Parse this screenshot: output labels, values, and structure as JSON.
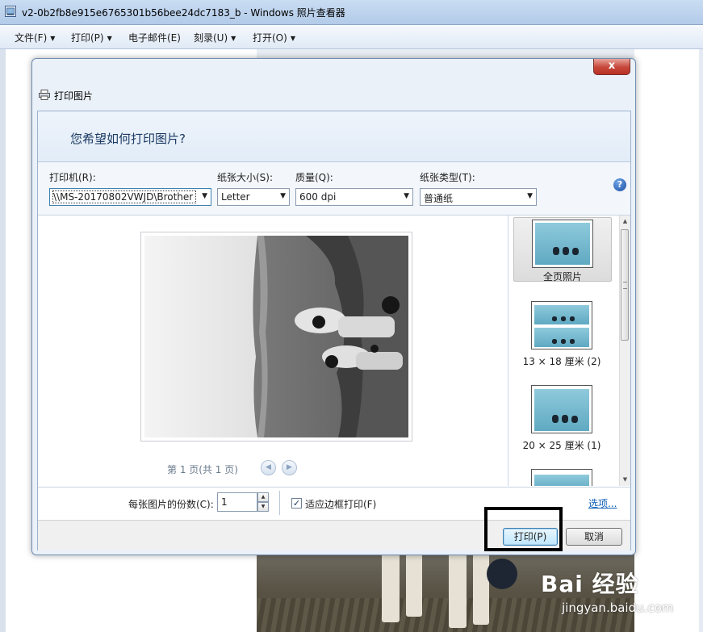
{
  "window": {
    "title": "v2-0b2fb8e915e6765301b56bee24dc7183_b - Windows 照片查看器"
  },
  "menu": {
    "items": [
      {
        "label": "文件(F)",
        "has_arrow": true
      },
      {
        "label": "打印(P)",
        "has_arrow": true
      },
      {
        "label": "电子邮件(E)",
        "has_arrow": false
      },
      {
        "label": "刻录(U)",
        "has_arrow": true
      },
      {
        "label": "打开(O)",
        "has_arrow": true
      }
    ],
    "arrow_glyph": "▼"
  },
  "dialog": {
    "title": "打印图片",
    "close_glyph": "x",
    "heading": "您希望如何打印图片?",
    "printer": {
      "label": "打印机(R):",
      "value": "\\\\MS-20170802VWJD\\Brother"
    },
    "paper_size": {
      "label": "纸张大小(S):",
      "value": "Letter"
    },
    "quality": {
      "label": "质量(Q):",
      "value": "600 dpi"
    },
    "paper_type": {
      "label": "纸张类型(T):",
      "value": "普通纸"
    },
    "help_glyph": "?",
    "page_indicator": "第 1 页(共 1 页)",
    "layouts": [
      {
        "label": "全页照片",
        "selected": true
      },
      {
        "label": "13 × 18 厘米 (2)",
        "selected": false
      },
      {
        "label": "20 × 25 厘米 (1)",
        "selected": false
      }
    ],
    "copies": {
      "label": "每张图片的份数(C):",
      "value": "1"
    },
    "fit_to_frame": {
      "label": "适应边框打印(F)",
      "checked": true,
      "check_glyph": "✓"
    },
    "options_link": "选项...",
    "print_button": "打印(P)",
    "cancel_button": "取消"
  },
  "watermark": {
    "logo": "Bai 经验",
    "url": "jingyan.baidu.com"
  },
  "colors": {
    "accent": "#3c7fb1",
    "link": "#0b5db8",
    "close": "#c7463a"
  }
}
